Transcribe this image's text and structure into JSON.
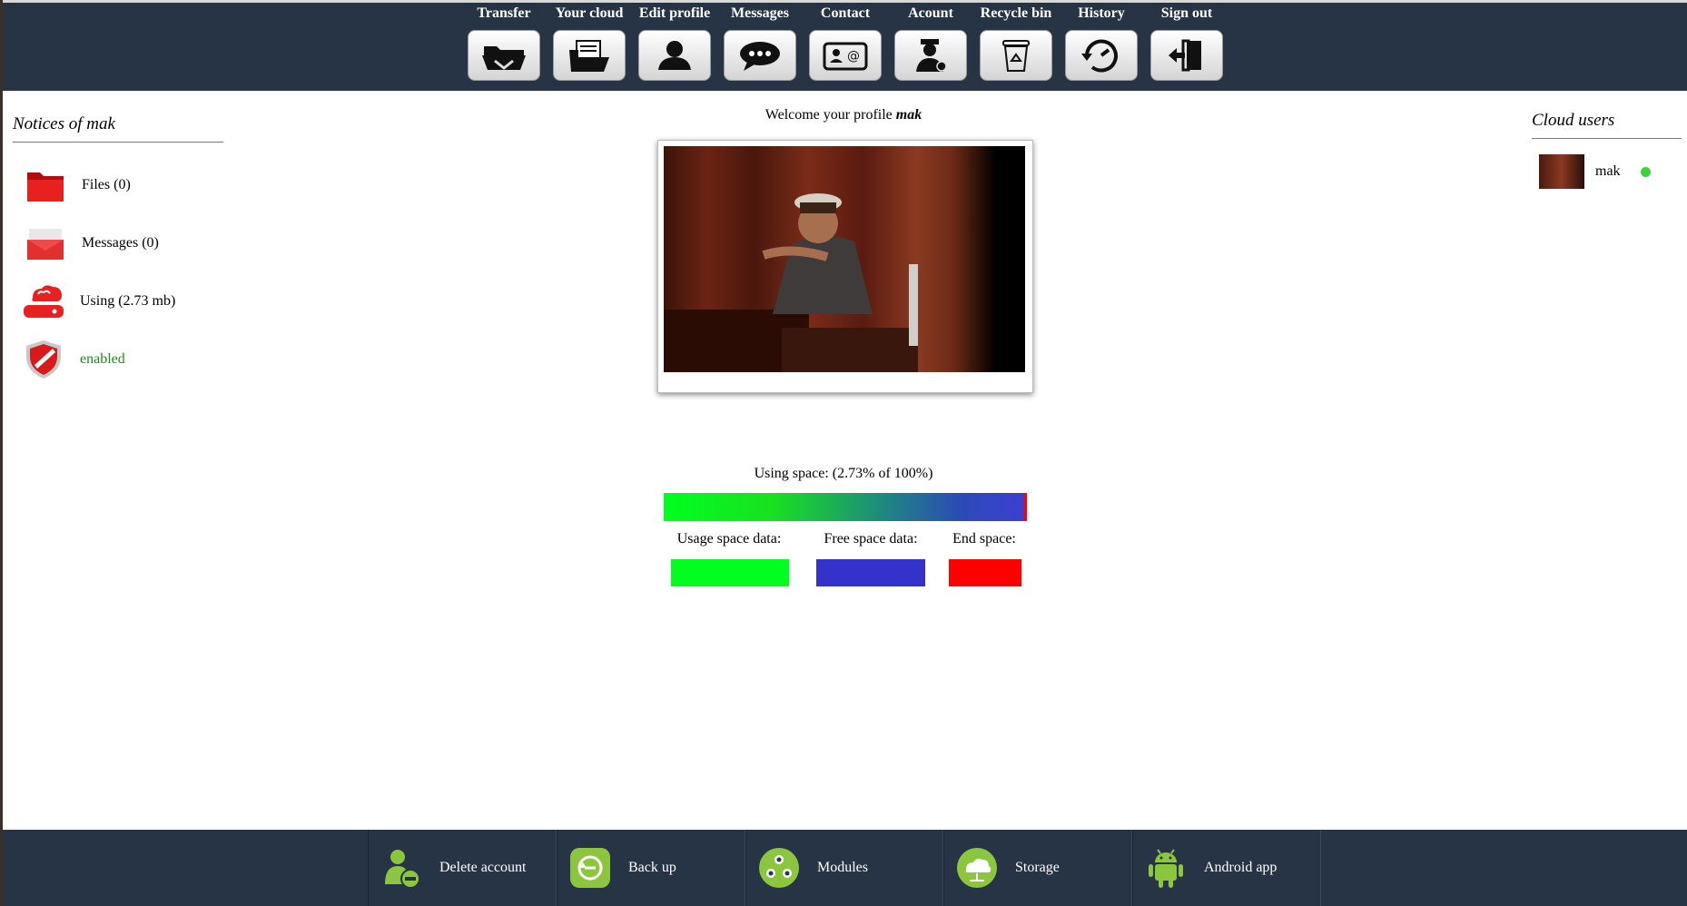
{
  "nav": {
    "items": [
      {
        "label": "Transfer",
        "icon": "transfer-icon"
      },
      {
        "label": "Your cloud",
        "icon": "cloud-folder-icon"
      },
      {
        "label": "Edit profile",
        "icon": "user-icon"
      },
      {
        "label": "Messages",
        "icon": "chat-icon"
      },
      {
        "label": "Contact",
        "icon": "contact-card-icon"
      },
      {
        "label": "Acount",
        "icon": "account-icon"
      },
      {
        "label": "Recycle bin",
        "icon": "recycle-bin-icon"
      },
      {
        "label": "History",
        "icon": "history-icon"
      },
      {
        "label": "Sign out",
        "icon": "sign-out-icon"
      }
    ]
  },
  "left": {
    "title": "Notices of mak",
    "files": "Files (0)",
    "messages": "Messages (0)",
    "using": "Using (2.73 mb)",
    "status": "enabled"
  },
  "main": {
    "welcome_prefix": "Welcome your profile ",
    "username": "mak",
    "space_text": "Using space: (2.73% of 100%)",
    "usage_percent": 2.73,
    "legend": {
      "usage": "Usage space data:",
      "free": "Free space data:",
      "end": "End space:"
    }
  },
  "right": {
    "title": "Cloud users",
    "users": [
      {
        "name": "mak",
        "online": true
      }
    ]
  },
  "bottom": {
    "items": [
      {
        "label": "Delete account",
        "icon": "delete-account-icon"
      },
      {
        "label": "Back up",
        "icon": "backup-icon"
      },
      {
        "label": "Modules",
        "icon": "modules-icon"
      },
      {
        "label": "Storage",
        "icon": "storage-icon"
      },
      {
        "label": "Android app",
        "icon": "android-icon"
      }
    ]
  },
  "colors": {
    "bar_bg": "#263445",
    "usage": "#00ff1e",
    "free": "#3333cc",
    "end": "#ff0000",
    "enabled": "#1f8a1f",
    "online": "#38d438"
  }
}
